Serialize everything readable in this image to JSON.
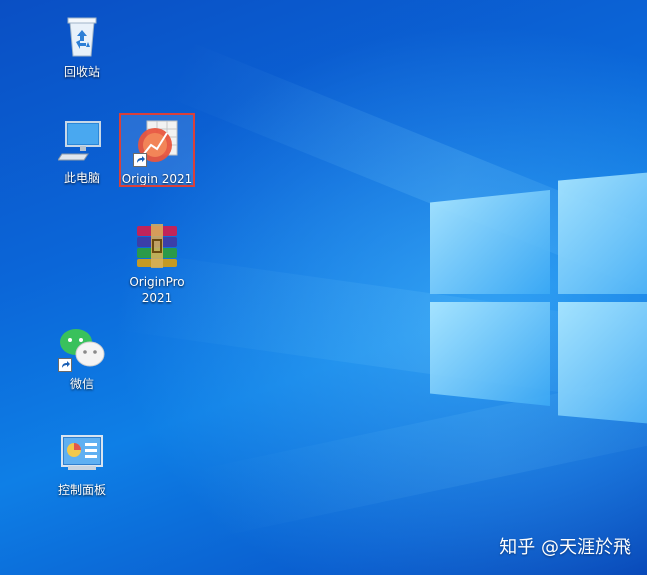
{
  "desktop": {
    "icons": [
      {
        "label": "回收站",
        "icon": "recycle-bin-icon"
      },
      {
        "label": "此电脑",
        "icon": "computer-icon"
      },
      {
        "label": "Origin 2021",
        "icon": "origin-app-icon",
        "selected": true
      },
      {
        "label": "OriginPro\n2021",
        "icon": "winrar-archive-icon"
      },
      {
        "label": "微信",
        "icon": "wechat-icon"
      },
      {
        "label": "控制面板",
        "icon": "control-panel-icon"
      }
    ],
    "selection_color": "#d9403a"
  },
  "watermark": {
    "text": "知乎 @天涯於飛"
  },
  "colors": {
    "wallpaper_base": "#0a64d6",
    "logo_glow": "#8cdcff"
  }
}
